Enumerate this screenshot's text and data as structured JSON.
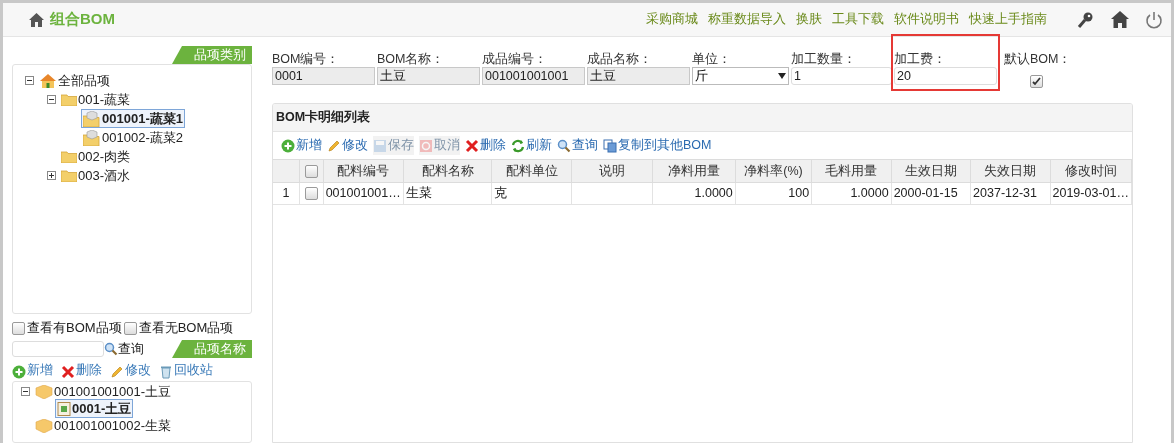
{
  "header": {
    "title": "组合BOM",
    "links": [
      "采购商城",
      "称重数据导入",
      "换肤",
      "工具下载",
      "软件说明书",
      "快速上手指南"
    ]
  },
  "category_panel": {
    "tab": "品项类别",
    "tree": [
      {
        "label": "全部品项",
        "kind": "root",
        "expanded": true,
        "selected": false,
        "children": [
          {
            "label": "001-蔬菜",
            "kind": "folder",
            "expanded": true,
            "selected": false,
            "children": [
              {
                "label": "001001-蔬菜1",
                "kind": "leaf",
                "selected": true
              },
              {
                "label": "001002-蔬菜2",
                "kind": "leaf",
                "selected": false
              }
            ]
          },
          {
            "label": "002-肉类",
            "kind": "folder",
            "selected": false
          },
          {
            "label": "003-酒水",
            "kind": "folder",
            "expanded": false,
            "selected": false
          }
        ]
      }
    ]
  },
  "filters": [
    {
      "label": "查看有BOM品项",
      "checked": false
    },
    {
      "label": "查看无BOM品项",
      "checked": false
    }
  ],
  "search": {
    "button": "查询"
  },
  "item_panel": {
    "tab": "品项名称",
    "actions": [
      {
        "label": "新增",
        "kind": "add"
      },
      {
        "label": "删除",
        "kind": "delete"
      },
      {
        "label": "修改",
        "kind": "edit"
      },
      {
        "label": "回收站",
        "kind": "recycle"
      }
    ],
    "tree": [
      {
        "label": "001001001001-土豆",
        "kind": "product",
        "expanded": true,
        "selected": false,
        "children": [
          {
            "label": "0001-土豆",
            "kind": "bom",
            "selected": true
          }
        ]
      },
      {
        "label": "001001001002-生菜",
        "kind": "product",
        "selected": false
      }
    ]
  },
  "form": {
    "fields": [
      {
        "label": "BOM编号：",
        "value": "0001",
        "kind": "readonly"
      },
      {
        "label": "BOM名称：",
        "value": "土豆",
        "kind": "readonly"
      },
      {
        "label": "成品编号：",
        "value": "001001001001",
        "kind": "readonly"
      },
      {
        "label": "成品名称：",
        "value": "土豆",
        "kind": "readonly"
      },
      {
        "label": "单位：",
        "value": "斤",
        "kind": "select"
      },
      {
        "label": "加工数量：",
        "value": "1",
        "kind": "text"
      },
      {
        "label": "加工费：",
        "value": "20",
        "kind": "text",
        "highlighted": true
      },
      {
        "label": "默认BOM：",
        "kind": "checkbox",
        "checked": true
      }
    ]
  },
  "grid": {
    "title": "BOM卡明细列表",
    "toolbar": [
      {
        "label": "新增",
        "kind": "add",
        "disabled": false
      },
      {
        "label": "修改",
        "kind": "edit",
        "disabled": false
      },
      {
        "label": "保存",
        "kind": "save",
        "disabled": true
      },
      {
        "label": "取消",
        "kind": "cancel",
        "disabled": true
      },
      {
        "label": "删除",
        "kind": "delete",
        "disabled": false
      },
      {
        "label": "刷新",
        "kind": "refresh",
        "disabled": false
      },
      {
        "label": "查询",
        "kind": "search",
        "disabled": false
      },
      {
        "label": "复制到其他BOM",
        "kind": "copy",
        "disabled": false
      }
    ],
    "select_all": {
      "checked": false
    },
    "columns": [
      "配料编号",
      "配料名称",
      "配料单位",
      "说明",
      "净料用量",
      "净料率(%)",
      "毛料用量",
      "生效日期",
      "失效日期",
      "修改时间"
    ],
    "rows": [
      {
        "index": "1",
        "checked": false,
        "cells": [
          "001001001…",
          "生菜",
          "克",
          "",
          "1.0000",
          "100",
          "1.0000",
          "2000-01-15",
          "2037-12-31",
          "2019-03-01…"
        ]
      }
    ]
  }
}
